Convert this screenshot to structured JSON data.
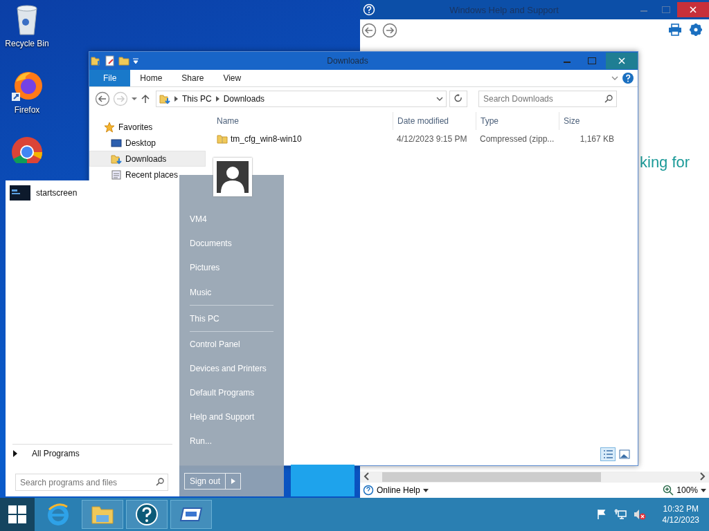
{
  "desktop_icons": [
    {
      "kind": "recycle",
      "label": "Recycle Bin"
    },
    {
      "kind": "firefox",
      "label": "Firefox"
    },
    {
      "kind": "chrome"
    }
  ],
  "help_window": {
    "title": "Windows Help and Support",
    "heading_fragment": "king for",
    "online_help": "Online Help",
    "zoom": "100%"
  },
  "explorer": {
    "title": "Downloads",
    "ribbon_tabs": [
      {
        "label": "File",
        "kind": "file"
      },
      {
        "label": "Home",
        "kind": "tab"
      },
      {
        "label": "Share",
        "kind": "tab"
      },
      {
        "label": "View",
        "kind": "tab"
      }
    ],
    "breadcrumb": [
      "This PC",
      "Downloads"
    ],
    "search": {
      "placeholder": "Search Downloads"
    },
    "nav": [
      {
        "label": "Favorites",
        "kind": "favorites",
        "selected": false
      },
      {
        "label": "Desktop",
        "kind": "desktop",
        "selected": false
      },
      {
        "label": "Downloads",
        "kind": "downloads",
        "selected": true
      },
      {
        "label": "Recent places",
        "kind": "recent",
        "selected": false
      }
    ],
    "columns": [
      "Name",
      "Date modified",
      "Type",
      "Size"
    ],
    "rows": [
      {
        "name": "tm_cfg_win8-win10",
        "date": "4/12/2023 9:15 PM",
        "type": "Compressed (zipp...",
        "size": "1,167 KB"
      }
    ],
    "views": [
      {
        "kind": "details",
        "selected": true
      },
      {
        "kind": "large",
        "selected": false
      }
    ]
  },
  "start_menu": {
    "programs": [
      {
        "label": "startscreen"
      }
    ],
    "all_programs": "All Programs",
    "search": {
      "placeholder": "Search programs and files"
    },
    "places": [
      {
        "label": "VM4",
        "separator_after": false
      },
      {
        "label": "Documents",
        "separator_after": false
      },
      {
        "label": "Pictures",
        "separator_after": false
      },
      {
        "label": "Music",
        "separator_after": true
      },
      {
        "label": "This PC",
        "separator_after": true
      },
      {
        "label": "Control Panel",
        "separator_after": false
      },
      {
        "label": "Devices and Printers",
        "separator_after": false
      },
      {
        "label": "Default Programs",
        "separator_after": false
      },
      {
        "label": "Help and Support",
        "separator_after": false
      },
      {
        "label": "Run...",
        "separator_after": false
      }
    ],
    "sign_out": "Sign out"
  },
  "taskbar": {
    "apps": [
      {
        "kind": "ie",
        "open": false
      },
      {
        "kind": "explorer",
        "open": true
      },
      {
        "kind": "help",
        "open": true
      },
      {
        "kind": "remote",
        "open": true
      }
    ],
    "tray": [
      {
        "kind": "flag"
      },
      {
        "kind": "network"
      },
      {
        "kind": "speaker-muted"
      }
    ],
    "time": "10:32 PM",
    "date": "4/12/2023"
  }
}
